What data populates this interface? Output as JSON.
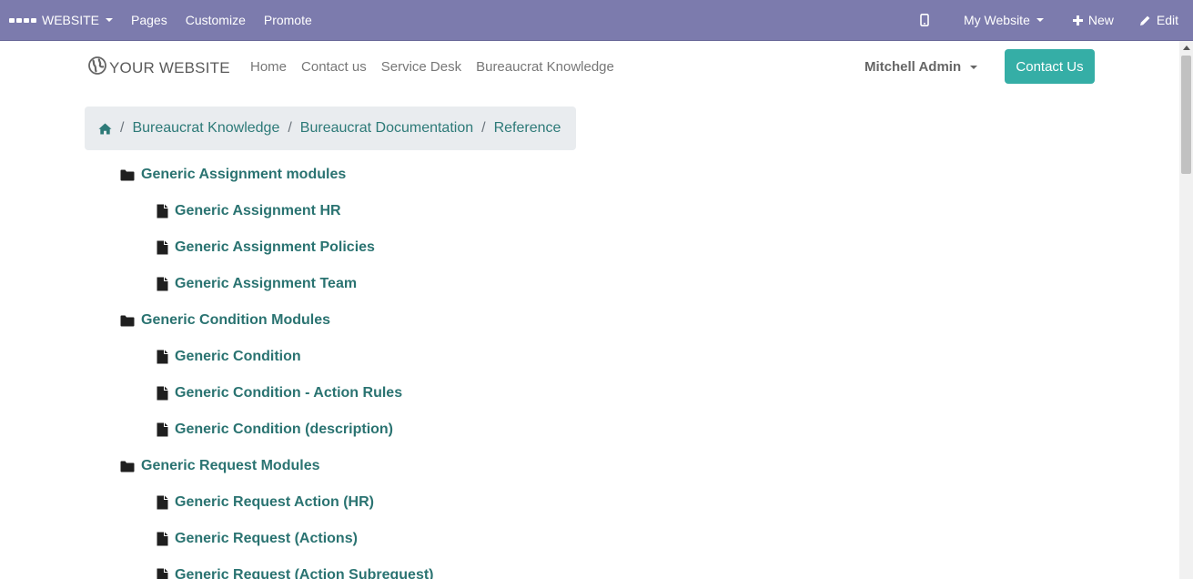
{
  "adminbar": {
    "website_label": "WEBSITE",
    "pages_label": "Pages",
    "customize_label": "Customize",
    "promote_label": "Promote",
    "my_website_label": "My Website",
    "new_label": "New",
    "edit_label": "Edit"
  },
  "header": {
    "brand": "YOUR WEBSITE",
    "nav": [
      "Home",
      "Contact us",
      "Service Desk",
      "Bureaucrat Knowledge"
    ],
    "user": "Mitchell Admin",
    "cta": "Contact Us"
  },
  "breadcrumb": {
    "items": [
      "Bureaucrat Knowledge",
      "Bureaucrat Documentation",
      "Reference"
    ],
    "separator": "/"
  },
  "tree": [
    {
      "type": "folder",
      "label": "Generic Assignment modules"
    },
    {
      "type": "file",
      "label": "Generic Assignment HR"
    },
    {
      "type": "file",
      "label": "Generic Assignment Policies"
    },
    {
      "type": "file",
      "label": "Generic Assignment Team"
    },
    {
      "type": "folder",
      "label": "Generic Condition Modules"
    },
    {
      "type": "file",
      "label": "Generic Condition"
    },
    {
      "type": "file",
      "label": "Generic Condition - Action Rules"
    },
    {
      "type": "file",
      "label": "Generic Condition (description)"
    },
    {
      "type": "folder",
      "label": "Generic Request Modules"
    },
    {
      "type": "file",
      "label": "Generic Request Action (HR)"
    },
    {
      "type": "file",
      "label": "Generic Request (Actions)"
    },
    {
      "type": "file",
      "label": "Generic Request (Action Subrequest)"
    }
  ],
  "colors": {
    "adminbar": "#7c7bad",
    "accent": "#35aea6",
    "link": "#2a7371",
    "breadcrumb_bg": "#e9ecef"
  }
}
